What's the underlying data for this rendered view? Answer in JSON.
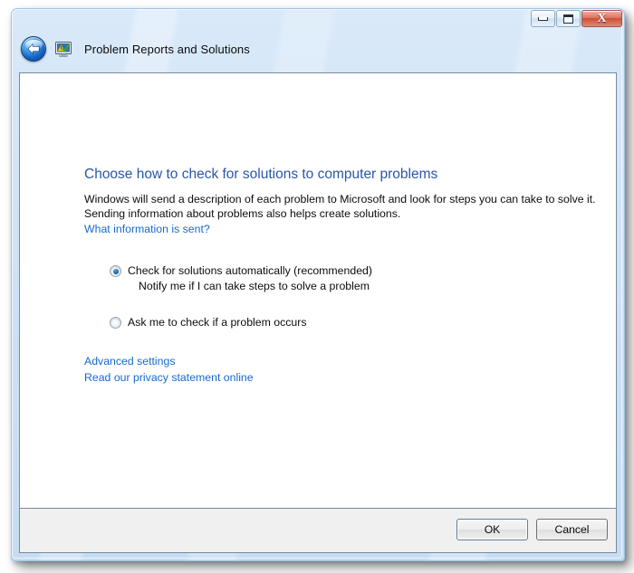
{
  "window": {
    "title": "Problem Reports and Solutions",
    "app_icon": "problem-reports-monitor-icon",
    "back_icon": "back-arrow-icon",
    "controls": {
      "minimize": "minimize-icon",
      "maximize": "maximize-restore-icon",
      "close_glyph": "X"
    }
  },
  "content": {
    "heading": "Choose how to check for solutions to computer problems",
    "body_line1": "Windows will send a description of each problem to Microsoft and look for steps you can take to solve it.",
    "body_line2": "Sending information about problems also helps create solutions.",
    "what_is_sent_link": "What information is sent?",
    "options": [
      {
        "label": "Check for solutions automatically (recommended)",
        "sublabel": "Notify me if I can take steps to solve a problem",
        "checked": true
      },
      {
        "label": "Ask me to check if a problem occurs",
        "sublabel": "",
        "checked": false
      }
    ],
    "advanced_settings_link": "Advanced settings",
    "privacy_statement_link": "Read our privacy statement online"
  },
  "footer": {
    "ok_label": "OK",
    "cancel_label": "Cancel"
  },
  "colors": {
    "heading_blue": "#2a57a5",
    "link_blue": "#1669cf",
    "frame_blue": "#cfe2f6",
    "close_red": "#c8503a",
    "footer_gray": "#f0f0f0"
  }
}
